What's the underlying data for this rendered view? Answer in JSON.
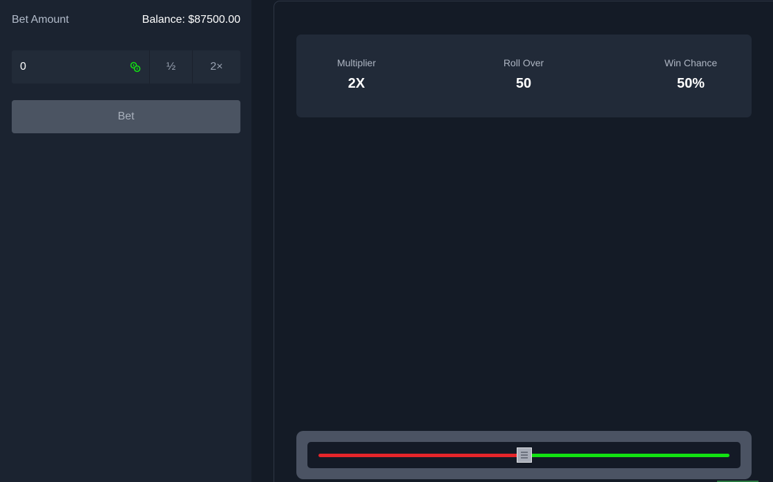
{
  "sidebar": {
    "bet_amount_label": "Bet Amount",
    "balance_text": "Balance: $87500.00",
    "amount_value": "0",
    "coin_icon": "coin-stack-icon",
    "half_label": "½",
    "double_label": "2×",
    "bet_button_label": "Bet"
  },
  "stats": {
    "multiplier_label": "Multiplier",
    "multiplier_value": "2X",
    "rollover_label": "Roll Over",
    "rollover_value": "50",
    "winchance_label": "Win Chance",
    "winchance_value": "50%"
  },
  "slider": {
    "value_percent": 50,
    "lose_color": "#e5252a",
    "win_color": "#12e212",
    "handle_icon": "drag-handle-icon"
  },
  "colors": {
    "accent_green": "#12e212",
    "bet_button_bg": "#4b5462"
  }
}
